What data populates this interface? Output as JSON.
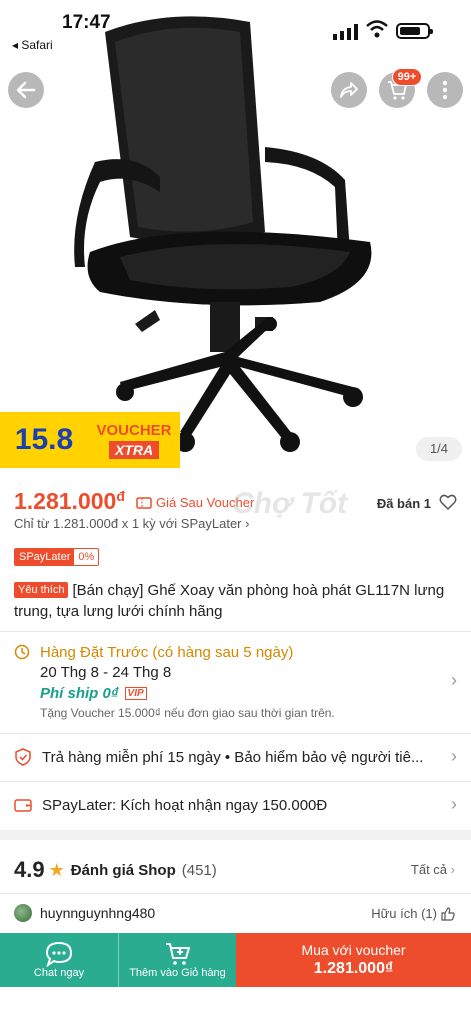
{
  "status": {
    "time": "17:47",
    "back_app": "◂ Safari"
  },
  "header": {
    "cart_badge": "99+"
  },
  "promo": {
    "number": "15.8",
    "voucher": "VOUCHER",
    "xtra": "XTRA"
  },
  "image_counter": "1/4",
  "product": {
    "price": "1.281.000",
    "currency": "đ",
    "price_note": "Giá Sau Voucher",
    "sold": "Đã bán 1",
    "installment": "Chỉ từ 1.281.000đ x 1 kỳ với SPayLater ›",
    "spaylater_label": "SPayLater",
    "spaylater_rate": "0%",
    "fav_tag": "Yêu thích",
    "title": "[Bán chạy] Ghế Xoay văn phòng hoà phát  GL117N lưng trung, tựa lưng lưới chính hãng"
  },
  "shipping": {
    "preorder": "Hàng Đặt Trước (có hàng sau 5 ngày)",
    "date": "20 Thg 8 - 24 Thg 8",
    "fee": "Phí ship 0₫",
    "vip": "VIP",
    "voucher_note": "Tặng Voucher 15.000₫ nếu đơn giao sau thời gian trên."
  },
  "returns": {
    "text": "Trả hàng miễn phí 15 ngày  •  Bảo hiểm bảo vệ người tiê..."
  },
  "spaylater_row": {
    "text": "SPayLater: Kích hoạt nhận ngay 150.000Đ"
  },
  "rating": {
    "score": "4.9",
    "label": "Đánh giá Shop",
    "count": "(451)",
    "see_all": "Tất cả"
  },
  "review": {
    "user": "huynnguynhng480",
    "helpful": "Hữu ích (1)"
  },
  "bottom_bar": {
    "chat": "Chat ngay",
    "add_cart": "Thêm vào Giỏ hàng",
    "buy_line1": "Mua với voucher",
    "buy_line2": "1.281.000₫"
  },
  "colors": {
    "brand": "#ee4d2d",
    "teal": "#2aac91",
    "promo_yellow": "#ffd200",
    "preorder": "#d48800",
    "free_ship": "#1aa08b"
  }
}
